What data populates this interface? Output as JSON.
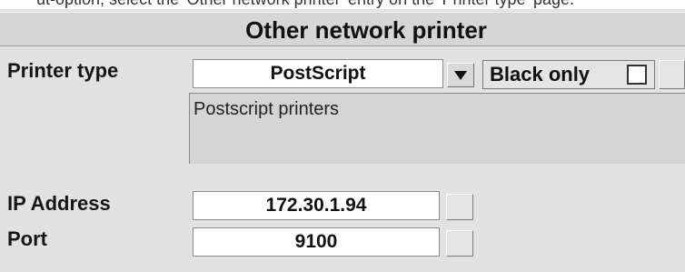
{
  "clipped_header_text": "ut-option, select the 'Other network printer' entry on the 'Printer type' page.",
  "section": {
    "title": "Other network printer"
  },
  "printer_type": {
    "label": "Printer type",
    "selected": "PostScript",
    "dropdown_icon": "triangle-down-icon",
    "description": "Postscript printers"
  },
  "black_only": {
    "label": "Black only",
    "checked": false
  },
  "ip_address": {
    "label": "IP Address",
    "value": "172.30.1.94"
  },
  "port": {
    "label": "Port",
    "value": "9100"
  },
  "colors": {
    "panel": "#e2e2e2",
    "title_bar": "#d6d6d6",
    "field_bg": "#ffffff",
    "description_bg": "#d4d4d4"
  }
}
